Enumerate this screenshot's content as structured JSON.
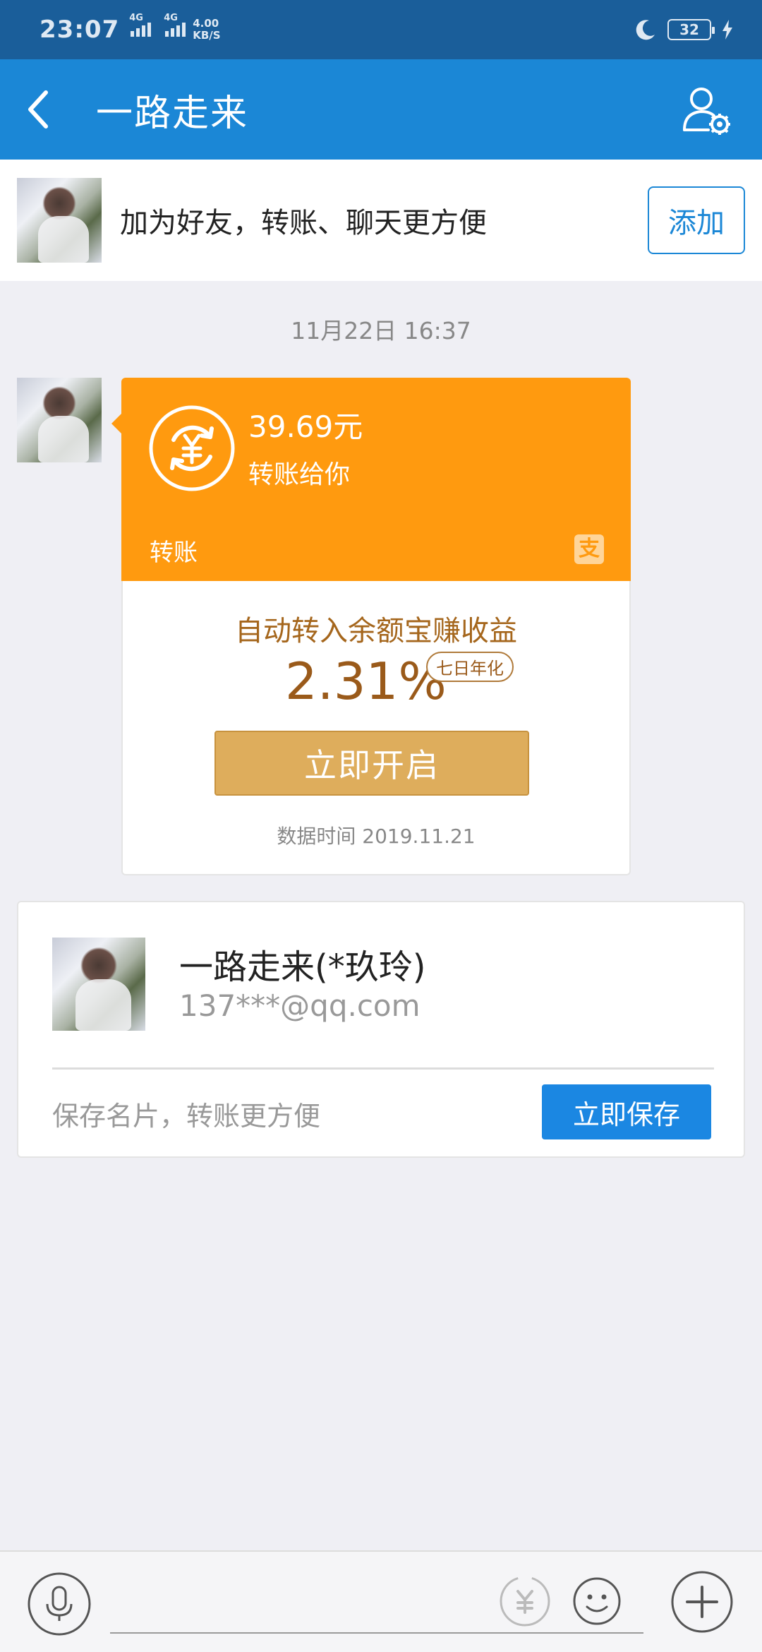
{
  "status_bar": {
    "time": "23:07",
    "network_1": "4G",
    "network_2": "4G",
    "speed_value": "4.00",
    "speed_unit": "KB/S",
    "battery": "32"
  },
  "header": {
    "title": "一路走来",
    "back_icon": "chevron-left-icon",
    "settings_icon": "user-settings-icon"
  },
  "friend_banner": {
    "text": "加为好友，转账、聊天更方便",
    "add_label": "添加"
  },
  "chat": {
    "timestamp": "11月22日 16:37",
    "transfer": {
      "amount": "39.69元",
      "description": "转账给你",
      "type_label": "转账",
      "alipay_glyph": "支",
      "promo_title": "自动转入余额宝赚收益",
      "rate": "2.31%",
      "rate_badge": "七日年化",
      "promo_button": "立即开启",
      "data_time": "数据时间 2019.11.21"
    }
  },
  "contact_card": {
    "name": "一路走来(*玖玲)",
    "account": "137***@qq.com",
    "hint": "保存名片，转账更方便",
    "save_label": "立即保存"
  },
  "input_bar": {
    "mic_icon": "microphone-icon",
    "transfer_icon": "yuan-transfer-icon",
    "emoji_icon": "smiley-icon",
    "plus_icon": "plus-icon"
  },
  "colors": {
    "status_bar": "#1a5e9a",
    "title_bar": "#1b87d6",
    "transfer_orange": "#ff9a0f",
    "promo_gold": "#dead5c",
    "save_blue": "#1b87e2"
  }
}
